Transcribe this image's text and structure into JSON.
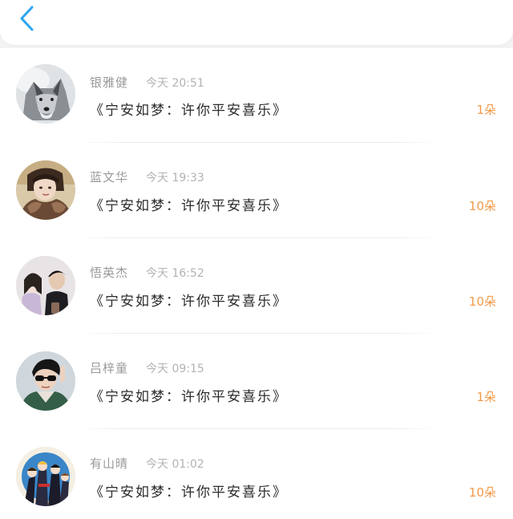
{
  "header": {
    "back_icon": "chevron-left-icon",
    "accent_color": "#2ba5f0"
  },
  "gifts": [
    {
      "name": "银雅健",
      "time": "今天 20:51",
      "title": "《宁安如梦：许你平安喜乐》",
      "count": "1朵",
      "avatar": "wolf-avatar"
    },
    {
      "name": "蓝文华",
      "time": "今天 19:33",
      "title": "《宁安如梦：许你平安喜乐》",
      "count": "10朵",
      "avatar": "woman-fur-coat-avatar"
    },
    {
      "name": "悟英杰",
      "time": "今天 16:52",
      "title": "《宁安如梦：许你平安喜乐》",
      "count": "10朵",
      "avatar": "couple-selfie-avatar"
    },
    {
      "name": "吕梓童",
      "time": "今天 09:15",
      "title": "《宁安如梦：许你平安喜乐》",
      "count": "1朵",
      "avatar": "man-sunglasses-avatar"
    },
    {
      "name": "有山晴",
      "time": "今天 01:02",
      "title": "《宁安如梦：许你平安喜乐》",
      "count": "10朵",
      "avatar": "anime-group-avatar"
    }
  ],
  "colors": {
    "count": "#f29a4a",
    "name": "#9a9a9a",
    "title": "#2b2b2b"
  }
}
